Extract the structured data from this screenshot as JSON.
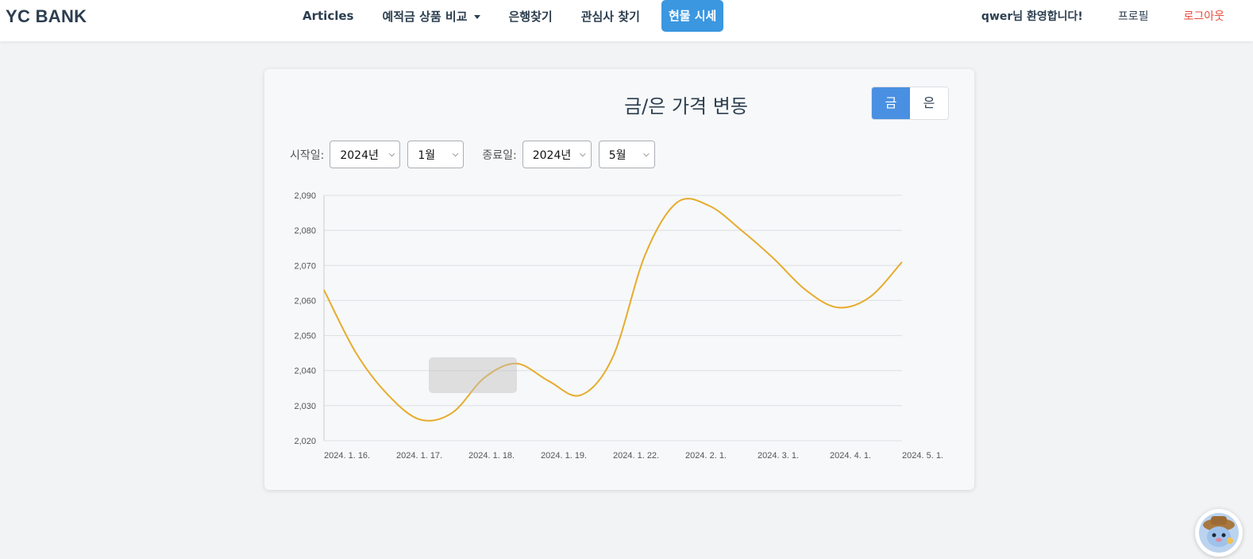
{
  "nav": {
    "brand": "YC BANK",
    "links": [
      "Articles",
      "예적금 상품 비교",
      "은행찾기",
      "관심사 찾기",
      "현물 시세"
    ],
    "welcome": "qwer님 환영합니다!",
    "profile": "프로필",
    "logout": "로그아웃"
  },
  "card": {
    "title": "금/은 가격 변동",
    "toggle": [
      "금",
      "은"
    ],
    "start_label": "시작일:",
    "end_label": "종료일:",
    "start_year": "2024년",
    "start_month": "1월",
    "end_year": "2024년",
    "end_month": "5월"
  },
  "colors": {
    "accent": "#3a97e0",
    "gold_line": "#e6ac2e",
    "logout": "#e74c3c"
  },
  "chart_data": {
    "type": "line",
    "categories": [
      "2024. 1. 16.",
      "2024. 1. 17.",
      "2024. 1. 18.",
      "2024. 1. 19.",
      "2024. 1. 22.",
      "2024. 2. 1.",
      "2024. 3. 1.",
      "2024. 4. 1.",
      "2024. 5. 1."
    ],
    "series": [
      {
        "values": [
          2063,
          2045,
          2033,
          2026,
          2028,
          2038,
          2042,
          2037,
          2033,
          2044,
          2073,
          2088,
          2087,
          2080,
          2072,
          2063,
          2058,
          2061,
          2071
        ]
      }
    ],
    "yticks": [
      2020,
      2030,
      2040,
      2050,
      2060,
      2070,
      2080,
      2090
    ],
    "ylim": [
      2020,
      2090
    ],
    "grid": true
  }
}
